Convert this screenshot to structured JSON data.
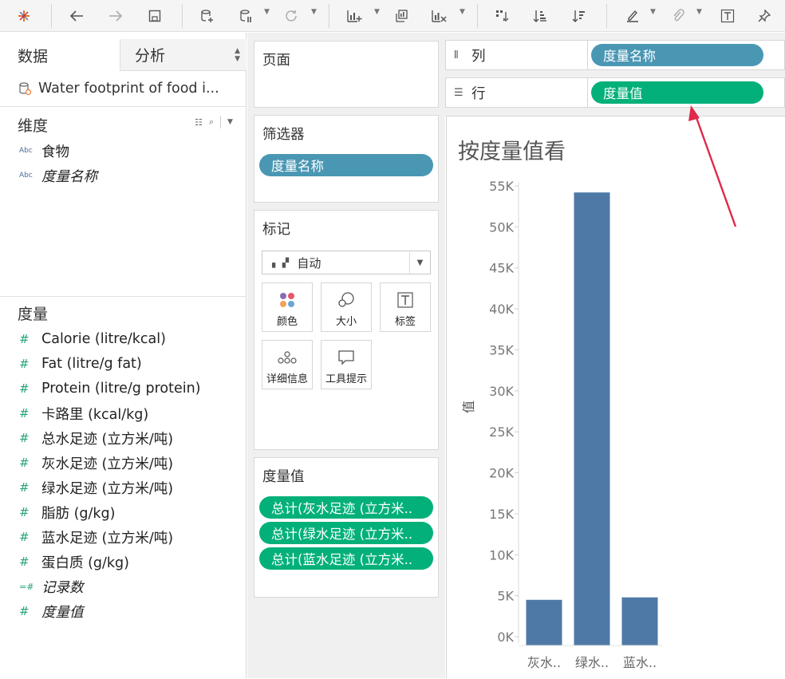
{
  "toolbar": {
    "icons": [
      "tableau-logo-icon",
      "undo-icon",
      "redo-icon",
      "save-icon",
      "new-datasource-icon",
      "pause-icon",
      "refresh-icon",
      "new-worksheet-icon",
      "duplicate-icon",
      "clear-icon",
      "swap-icon",
      "sort-ascending-icon",
      "sort-descending-icon",
      "highlight-icon",
      "attach-icon",
      "text-label-icon",
      "pin-icon"
    ]
  },
  "data_pane": {
    "tabs": {
      "data": "数据",
      "analysis": "分析"
    },
    "datasource": "Water footprint of food i...",
    "dimensions_title": "维度",
    "dimensions": [
      {
        "type": "Abc",
        "name": "食物",
        "italic": false
      },
      {
        "type": "Abc",
        "name": "度量名称",
        "italic": true
      }
    ],
    "measures_title": "度量",
    "measures": [
      {
        "name": "Calorie (litre/kcal)",
        "italic": false
      },
      {
        "name": "Fat (litre/g fat)",
        "italic": false
      },
      {
        "name": "Protein (litre/g protein)",
        "italic": false
      },
      {
        "name": "卡路里 (kcal/kg)",
        "italic": false
      },
      {
        "name": "总水足迹 (立方米/吨)",
        "italic": false
      },
      {
        "name": "灰水足迹 (立方米/吨)",
        "italic": false
      },
      {
        "name": "绿水足迹 (立方米/吨)",
        "italic": false
      },
      {
        "name": "脂肪 (g/kg)",
        "italic": false
      },
      {
        "name": "蓝水足迹 (立方米/吨)",
        "italic": false
      },
      {
        "name": "蛋白质 (g/kg)",
        "italic": false
      },
      {
        "name": "记录数",
        "italic": true
      },
      {
        "name": "度量值",
        "italic": true
      }
    ]
  },
  "pages": {
    "title": "页面"
  },
  "filters": {
    "title": "筛选器",
    "pill": "度量名称"
  },
  "marks": {
    "title": "标记",
    "type": "自动",
    "buttons": [
      "颜色",
      "大小",
      "标签",
      "详细信息",
      "工具提示"
    ]
  },
  "measure_values": {
    "title": "度量值",
    "pills": [
      "总计(灰水足迹 (立方米..",
      "总计(绿水足迹 (立方米..",
      "总计(蓝水足迹 (立方米.."
    ]
  },
  "shelves": {
    "columns": {
      "label": "列",
      "pill": "度量名称"
    },
    "rows": {
      "label": "行",
      "pill": "度量值"
    }
  },
  "colors": {
    "accent_blue": "#4a97b4",
    "accent_green": "#03b07a",
    "bar": "#4e79a7",
    "annotation": "#e0294b"
  },
  "chart_data": {
    "type": "bar",
    "title": "按度量值看",
    "ylabel": "值",
    "xlabel": "",
    "categories": [
      "灰水..",
      "绿水..",
      "蓝水.."
    ],
    "values": [
      4500,
      54200,
      4800
    ],
    "ylim": [
      0,
      55000
    ],
    "yticks": [
      0,
      5000,
      10000,
      15000,
      20000,
      25000,
      30000,
      35000,
      40000,
      45000,
      50000,
      55000
    ],
    "ytick_labels": [
      "0K",
      "5K",
      "10K",
      "15K",
      "20K",
      "25K",
      "30K",
      "35K",
      "40K",
      "45K",
      "50K",
      "55K"
    ],
    "grid": false,
    "legend": "none"
  }
}
